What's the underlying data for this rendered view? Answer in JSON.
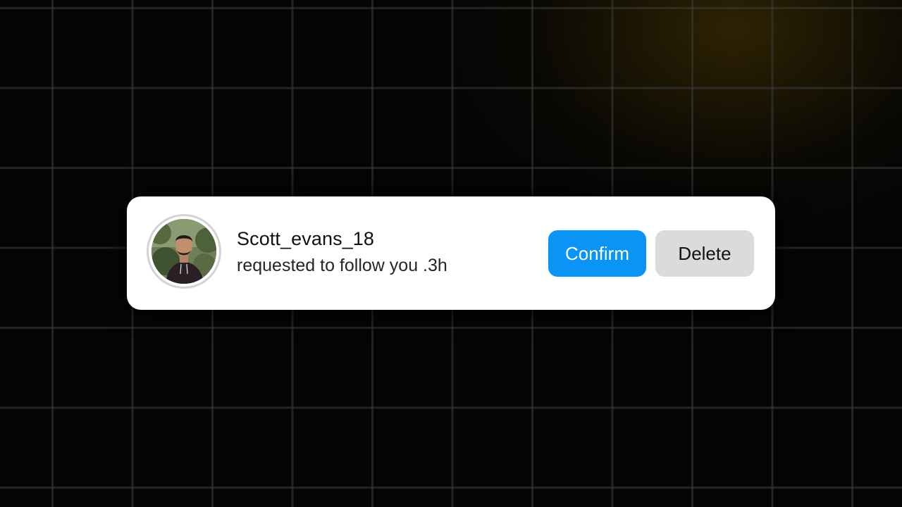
{
  "notification": {
    "username": "Scott_evans_18",
    "message": "requested to follow you .3h",
    "confirm_label": "Confirm",
    "delete_label": "Delete",
    "avatar_icon": "user-avatar-photo"
  },
  "colors": {
    "confirm_bg": "#0a95f6",
    "delete_bg": "#dbdbdb",
    "card_bg": "#ffffff",
    "page_bg": "#050505"
  }
}
